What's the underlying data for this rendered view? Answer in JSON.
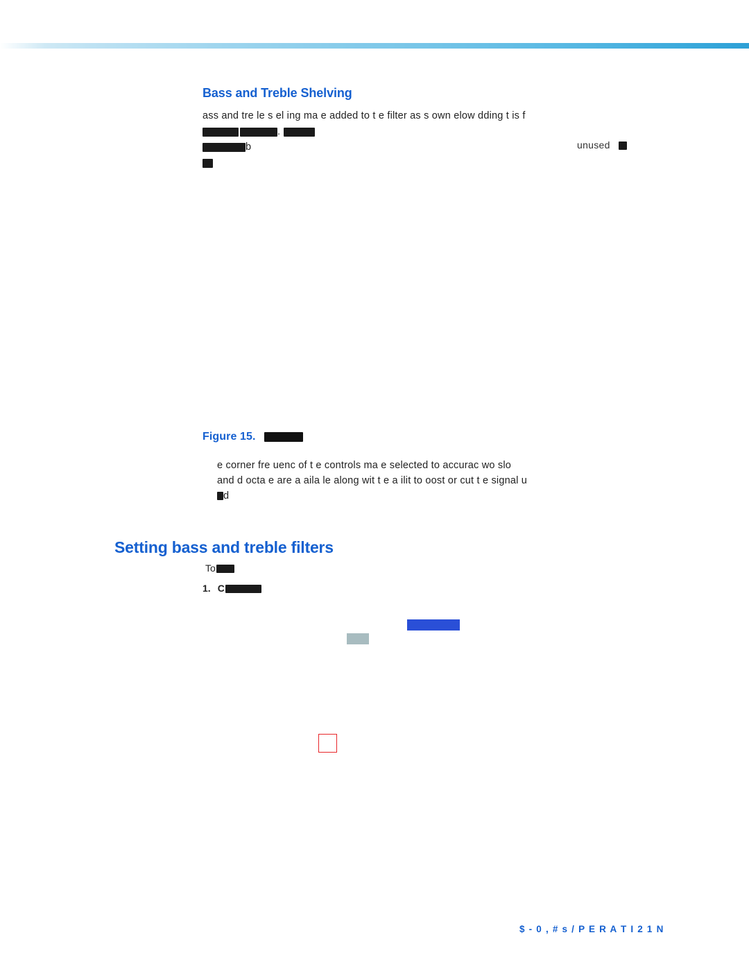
{
  "page": {
    "subhead": "Bass and Treble Shelving",
    "section_heading": "Setting bass and treble filters",
    "figure_caption_label": "Figure 15.",
    "unused_label": "unused",
    "procedure_intro": "To",
    "procedure_step_number": "1.",
    "procedure_step_text": "C",
    "footer_text": "$ - 0     , # s  / P E R A T I 2 1 N"
  },
  "paragraph1": {
    "line1": "ass and tre    le s   el  ing ma        e added to t   e filter   as s   own    elow            dding t   is f",
    "line2_visible": ".",
    "line3_visible": "b",
    "line4_visible": ""
  },
  "paragraph2": {
    "line1": "e corner fre   uenc   of t   e controls ma    e selected to                  accurac        wo slo",
    "line2": "and        d       octa   e are a    aila   le along wit    t   e a   ilit   to     oost or cut t   e signal u",
    "line3": "d"
  },
  "colors": {
    "heading_blue": "#1560d0",
    "rule_blue": "#2ea0d6",
    "ui_blue": "#2a4fd7",
    "ui_gray": "#a8bcc0",
    "highlight_red": "#e8262a"
  }
}
